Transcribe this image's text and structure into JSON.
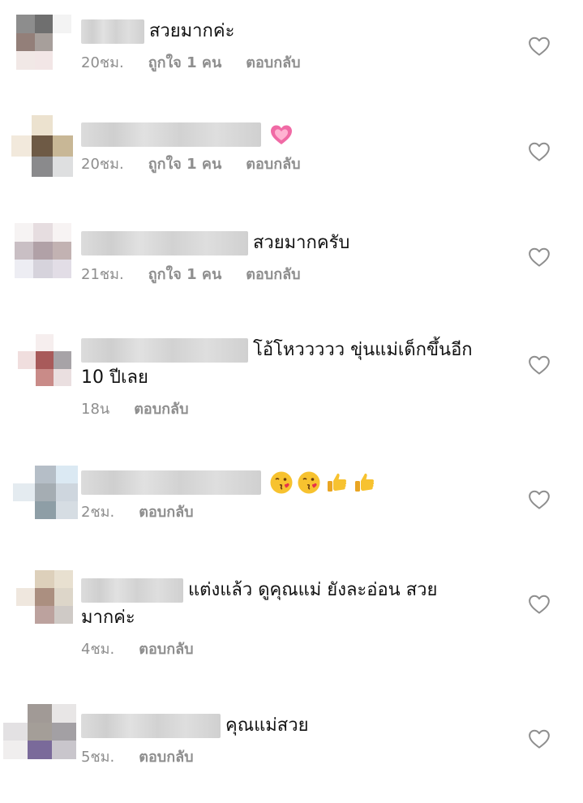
{
  "comments": [
    {
      "text": "สวยมากค่ะ",
      "time": "20ชม.",
      "likes": "ถูกใจ 1 คน",
      "reply": "ตอบกลับ",
      "avatar_colors": [
        "#8d8d8d",
        "#6f6f6f",
        "#f3f3f3",
        "#937f79",
        "#a79f9b",
        "#ffffff",
        "#f1e8e6",
        "#f2e6e6",
        "#ffffff"
      ]
    },
    {
      "text": "",
      "emojis": [
        "heart-emoji"
      ],
      "time": "20ชม.",
      "likes": "ถูกใจ 1 คน",
      "reply": "ตอบกลับ",
      "avatar_colors": [
        "#ffffff",
        "#ece2cf",
        "#ffffff",
        "#f2e9dc",
        "#6e5a45",
        "#c8b796",
        "#ffffff",
        "#8a8a8c",
        "#dedfe0"
      ]
    },
    {
      "text": "สวยมากครับ",
      "time": "21ชม.",
      "likes": "ถูกใจ 1 คน",
      "reply": "ตอบกลับ",
      "avatar_colors": [
        "#f6f3f3",
        "#e6dde0",
        "#f7f3f3",
        "#c9bfc4",
        "#b1a1a7",
        "#c2b2b2",
        "#ededf3",
        "#d6d3dc",
        "#e2dde6"
      ]
    },
    {
      "text": "โอ้โหววววว ขุ่นแม่เด็กขึ้นอีก",
      "text2": "10 ปีเลย",
      "time": "18น",
      "reply": "ตอบกลับ",
      "avatar_colors": [
        "#ffffff",
        "#f6eeee",
        "#ffffff",
        "#f0dede",
        "#a85a5a",
        "#a7a3a7",
        "#ffffff",
        "#c98b88",
        "#eadfe0"
      ]
    },
    {
      "text": "",
      "emojis": [
        "kiss-emoji",
        "kiss-emoji",
        "thumbs-up-emoji",
        "thumbs-up-emoji"
      ],
      "time": "2ชม.",
      "reply": "ตอบกลับ",
      "avatar_colors": [
        "#ffffff",
        "#b5bec7",
        "#dbe9f3",
        "#e4ebf0",
        "#a5adb3",
        "#ced6de",
        "#ffffff",
        "#8e9ea6",
        "#d6dde3"
      ]
    },
    {
      "text": "แต่งแล้ว ดูคุณแม่ ยังละอ่อน สวย",
      "text2": "มากค่ะ",
      "time": "4ชม.",
      "reply": "ตอบกลับ",
      "avatar_colors": [
        "#ffffff",
        "#ddd0bb",
        "#e8e0d0",
        "#efe7de",
        "#ab8f80",
        "#ddd6c9",
        "#ffffff",
        "#bca29e",
        "#cfcac6"
      ]
    },
    {
      "text": "คุณแม่สวย",
      "time": "5ชม.",
      "reply": "ตอบกลับ",
      "avatar_colors": [
        "#ffffff",
        "#a19a96",
        "#e8e6e6",
        "#e3e1e3",
        "#a49e98",
        "#a3a0a4",
        "#f0eeee",
        "#7a6a9a",
        "#c9c6cc"
      ]
    }
  ]
}
